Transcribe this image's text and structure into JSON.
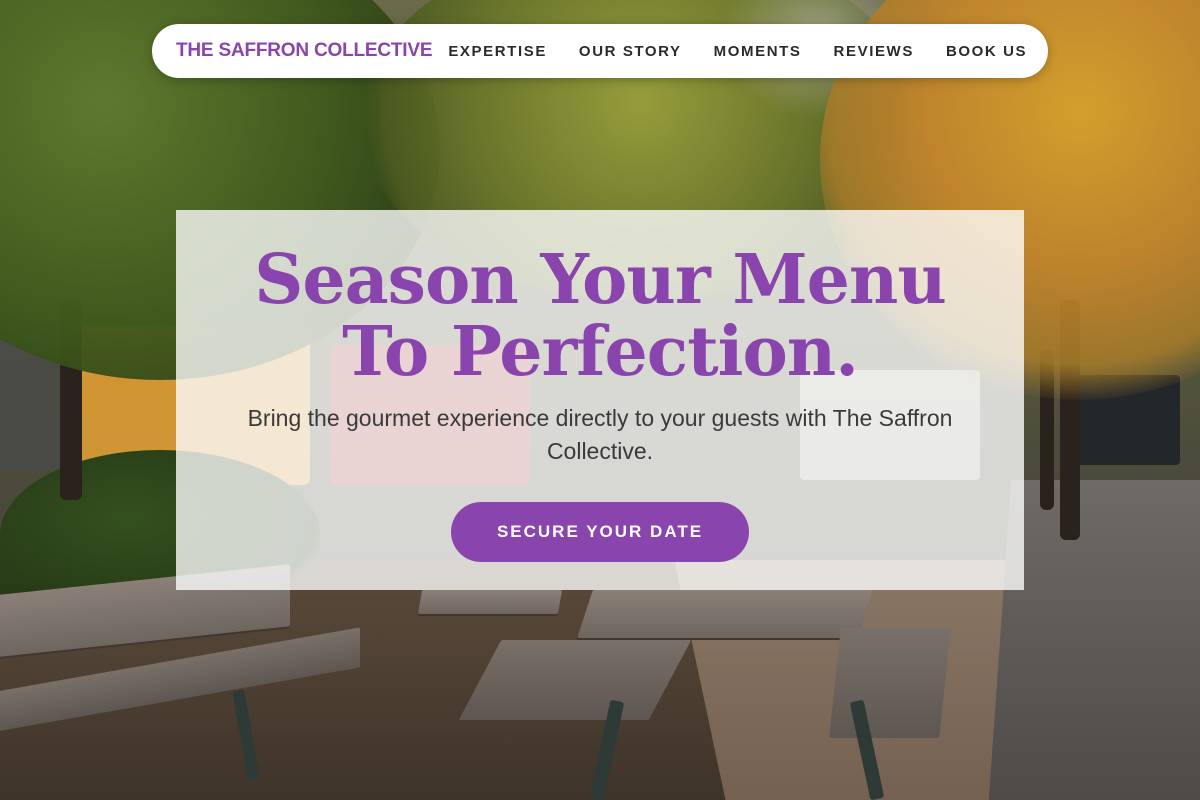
{
  "nav": {
    "brand": "THE SAFFRON COLLECTIVE",
    "links": [
      {
        "label": "EXPERTISE"
      },
      {
        "label": "OUR STORY"
      },
      {
        "label": "MOMENTS"
      },
      {
        "label": "REVIEWS"
      },
      {
        "label": "BOOK US"
      }
    ]
  },
  "hero": {
    "headline": "Season Your Menu To Perfection.",
    "subtext": "Bring the gourmet experience directly to your guests with The Saffron Collective.",
    "cta_label": "SECURE YOUR DATE"
  },
  "colors": {
    "accent": "#8a44ad",
    "nav_bg": "#ffffff",
    "card_overlay": "rgba(255,255,255,0.78)"
  }
}
